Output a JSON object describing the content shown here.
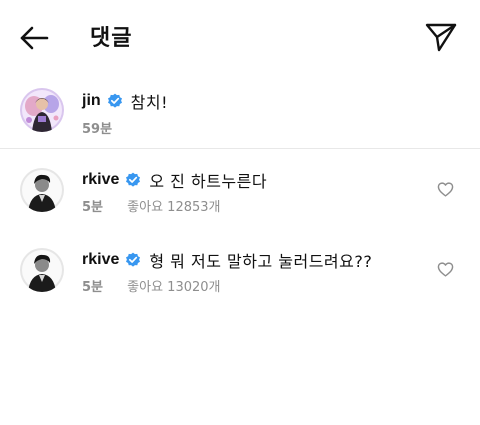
{
  "header": {
    "title": "댓글",
    "back_icon": "arrow-left-icon",
    "send_icon": "paper-plane-icon"
  },
  "caption": {
    "username": "jin",
    "verified": true,
    "text": "참치!",
    "time": "59분",
    "avatar": "avatar-jin"
  },
  "comments": [
    {
      "username": "rkive",
      "verified": true,
      "text": "오 진 하트누른다",
      "time": "5분",
      "likes": "좋아요 12853개",
      "avatar": "avatar-rkive"
    },
    {
      "username": "rkive",
      "verified": true,
      "text": "형 뭐 저도 말하고 눌러드려요??",
      "time": "5분",
      "likes": "좋아요 13020개",
      "avatar": "avatar-rkive"
    }
  ],
  "colors": {
    "verified_blue": "#3897f0",
    "meta_gray": "#8e8e8e",
    "text": "#111111"
  }
}
